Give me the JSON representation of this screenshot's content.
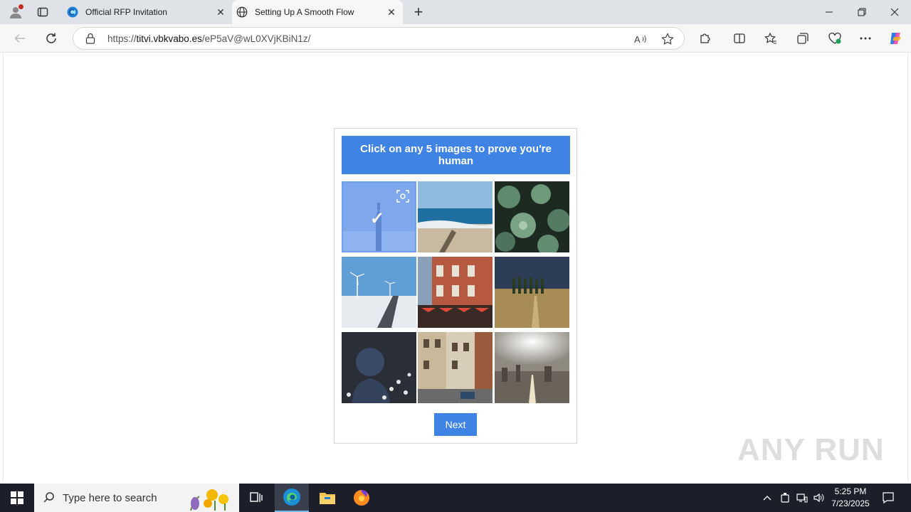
{
  "browser": {
    "tabs": [
      {
        "title": "Official RFP Invitation",
        "active": false
      },
      {
        "title": "Setting Up A Smooth Flow",
        "active": true
      }
    ],
    "url_prefix": "https://",
    "url_host": "titvi.vbkvabo.es",
    "url_path": "/eP5aV@wL0XVjKBiN1z/"
  },
  "captcha": {
    "instruction": "Click on any 5 images to prove you're human",
    "next_label": "Next",
    "images": [
      {
        "name": "tower-in-fog",
        "selected": true
      },
      {
        "name": "beach",
        "selected": false
      },
      {
        "name": "succulents",
        "selected": false
      },
      {
        "name": "wind-turbines-road",
        "selected": false
      },
      {
        "name": "brick-building-cafe",
        "selected": false
      },
      {
        "name": "tuscany-field",
        "selected": false
      },
      {
        "name": "hooded-person-flowers",
        "selected": false
      },
      {
        "name": "street-buildings",
        "selected": false
      },
      {
        "name": "city-skyline",
        "selected": false
      }
    ]
  },
  "watermark": "ANY RUN",
  "taskbar": {
    "search_placeholder": "Type here to search",
    "time": "5:25 PM",
    "date": "7/23/2025"
  },
  "colors": {
    "accent": "#3f84e5",
    "taskbar": "#1c1f2a"
  }
}
